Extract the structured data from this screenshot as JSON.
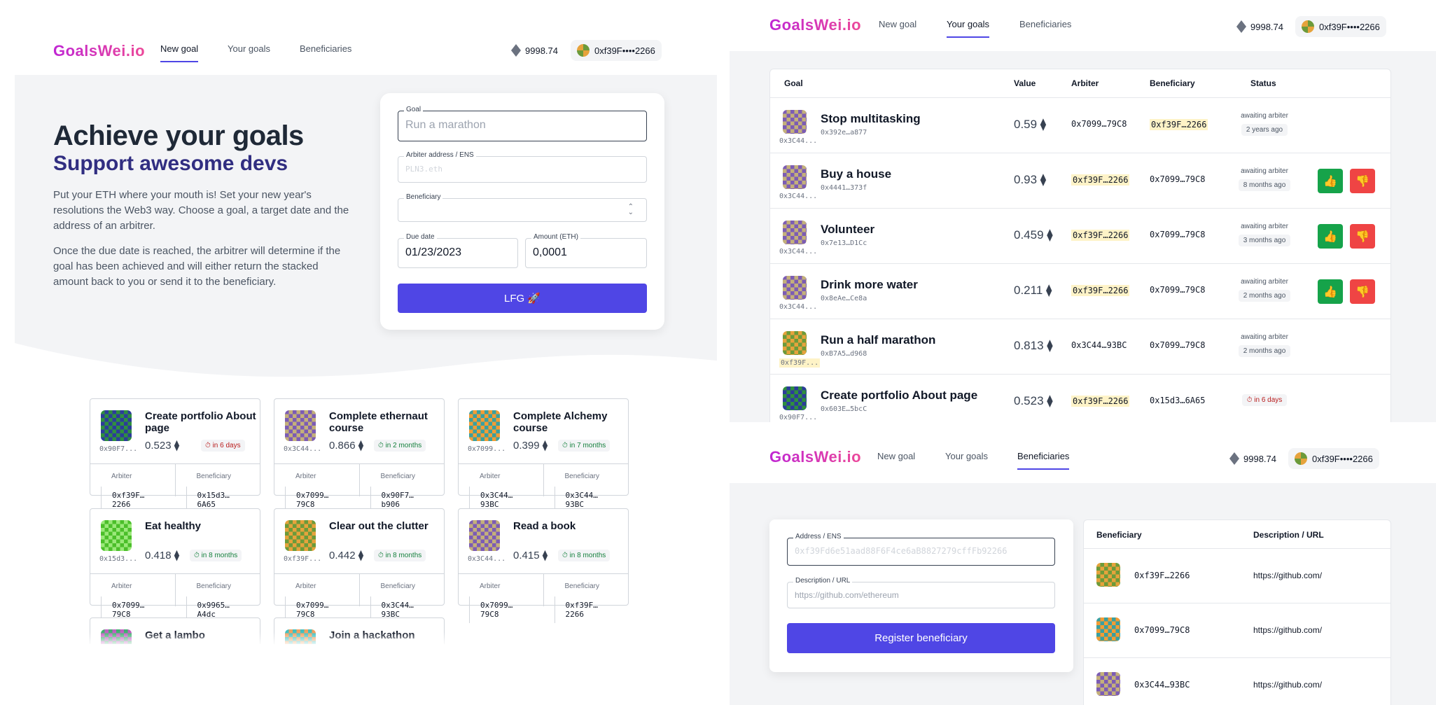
{
  "brand": "GoalsWei.io",
  "nav": {
    "new_goal": "New goal",
    "your_goals": "Your goals",
    "beneficiaries": "Beneficiaries"
  },
  "wallet": {
    "balance": "9998.74",
    "account": "0xf39F••••2266"
  },
  "hero": {
    "title": "Achieve your goals",
    "subtitle": "Support awesome devs",
    "p1": "Put your ETH where your mouth is! Set your new year's resolutions the Web3 way. Choose a goal, a target date and the address of an arbitrer.",
    "p2": "Once the due date is reached, the arbitrer will determine if the goal has been achieved and will either return the stacked amount back to you or send it to the beneficiary."
  },
  "form": {
    "goal_label": "Goal",
    "goal_placeholder": "Run a marathon",
    "arbiter_label": "Arbiter address / ENS",
    "arbiter_placeholder": "PLN3.eth",
    "beneficiary_label": "Beneficiary",
    "due_label": "Due date",
    "due_value": "01/23/2023",
    "amount_label": "Amount (ETH)",
    "amount_value": "0,0001",
    "submit": "LFG 🚀"
  },
  "cards_labels": {
    "arbiter": "Arbiter",
    "beneficiary": "Beneficiary"
  },
  "cards": [
    {
      "title": "Create portfolio About page",
      "addr": "0x90F7...",
      "value": "0.523 ⧫",
      "due": "⏱ in 6 days",
      "due_color": "red",
      "arbiter": "0xf39F…2266",
      "beneficiary": "0x15d3…6A65"
    },
    {
      "title": "Complete ethernaut course",
      "addr": "0x3C44...",
      "value": "0.866 ⧫",
      "due": "⏱ in 2 months",
      "due_color": "green",
      "arbiter": "0x7099…79C8",
      "beneficiary": "0x90F7…b906"
    },
    {
      "title": "Complete Alchemy course",
      "addr": "0x7099...",
      "value": "0.399 ⧫",
      "due": "⏱ in 7 months",
      "due_color": "green",
      "arbiter": "0x3C44…93BC",
      "beneficiary": "0x3C44…93BC"
    },
    {
      "title": "Eat healthy",
      "addr": "0x15d3...",
      "value": "0.418 ⧫",
      "due": "⏱ in 8 months",
      "due_color": "green",
      "arbiter": "0x7099…79C8",
      "beneficiary": "0x9965…A4dc"
    },
    {
      "title": "Clear out the clutter",
      "addr": "0xf39F...",
      "value": "0.442 ⧫",
      "due": "⏱ in 8 months",
      "due_color": "green",
      "arbiter": "0x7099…79C8",
      "beneficiary": "0x3C44…93BC"
    },
    {
      "title": "Read a book",
      "addr": "0x3C44...",
      "value": "0.415 ⧫",
      "due": "⏱ in 8 months",
      "due_color": "green",
      "arbiter": "0x7099…79C8",
      "beneficiary": "0xf39F…2266"
    },
    {
      "title": "Get a lambo"
    },
    {
      "title": "Join a hackathon"
    }
  ],
  "table": {
    "headers": {
      "goal": "Goal",
      "value": "Value",
      "arbiter": "Arbiter",
      "beneficiary": "Beneficiary",
      "status": "Status"
    },
    "rows": [
      {
        "title": "Stop multitasking",
        "sub": "0x392e…a877",
        "addr": "0x3C44...",
        "value": "0.59 ⧫",
        "arbiter": "0x7099…79C8",
        "beneficiary": "0xf39F…2266",
        "status": "awaiting arbiter",
        "ago": "2 years ago"
      },
      {
        "title": "Buy a house",
        "sub": "0x4441…373f",
        "addr": "0x3C44...",
        "value": "0.93 ⧫",
        "arbiter": "0xf39F…2266",
        "beneficiary": "0x7099…79C8",
        "status": "awaiting arbiter",
        "ago": "8 months ago"
      },
      {
        "title": "Volunteer",
        "sub": "0x7e13…D1Cc",
        "addr": "0x3C44...",
        "value": "0.459 ⧫",
        "arbiter": "0xf39F…2266",
        "beneficiary": "0x7099…79C8",
        "status": "awaiting arbiter",
        "ago": "3 months ago"
      },
      {
        "title": "Drink more water",
        "sub": "0x8eAe…Ce8a",
        "addr": "0x3C44...",
        "value": "0.211 ⧫",
        "arbiter": "0xf39F…2266",
        "beneficiary": "0x7099…79C8",
        "status": "awaiting arbiter",
        "ago": "2 months ago"
      },
      {
        "title": "Run a half marathon",
        "sub": "0xB7A5…d968",
        "addr": "0xf39F...",
        "value": "0.813 ⧫",
        "arbiter": "0x3C44…93BC",
        "beneficiary": "0x7099…79C8",
        "status": "awaiting arbiter",
        "ago": "2 months ago"
      },
      {
        "title": "Create portfolio About page",
        "sub": "0x603E…5bcC",
        "addr": "0x90F7...",
        "value": "0.523 ⧫",
        "arbiter": "0xf39F…2266",
        "beneficiary": "0x15d3…6A65",
        "status": "",
        "ago": "⏱ in 6 days"
      }
    ],
    "vote_up": "👍",
    "vote_down": "👎"
  },
  "beneficiary_form": {
    "address_label": "Address / ENS",
    "address_placeholder": "0xf39Fd6e51aad88F6F4ce6aB8827279cffFb92266",
    "desc_label": "Description / URL",
    "desc_placeholder": "https://github.com/ethereum",
    "submit": "Register beneficiary"
  },
  "beneficiary_table": {
    "headers": {
      "beneficiary": "Beneficiary",
      "desc": "Description / URL"
    },
    "rows": [
      {
        "addr": "0xf39F…2266",
        "desc": "https://github.com/"
      },
      {
        "addr": "0x7099…79C8",
        "desc": "https://github.com/"
      },
      {
        "addr": "0x3C44…93BC",
        "desc": "https://github.com/"
      }
    ]
  }
}
